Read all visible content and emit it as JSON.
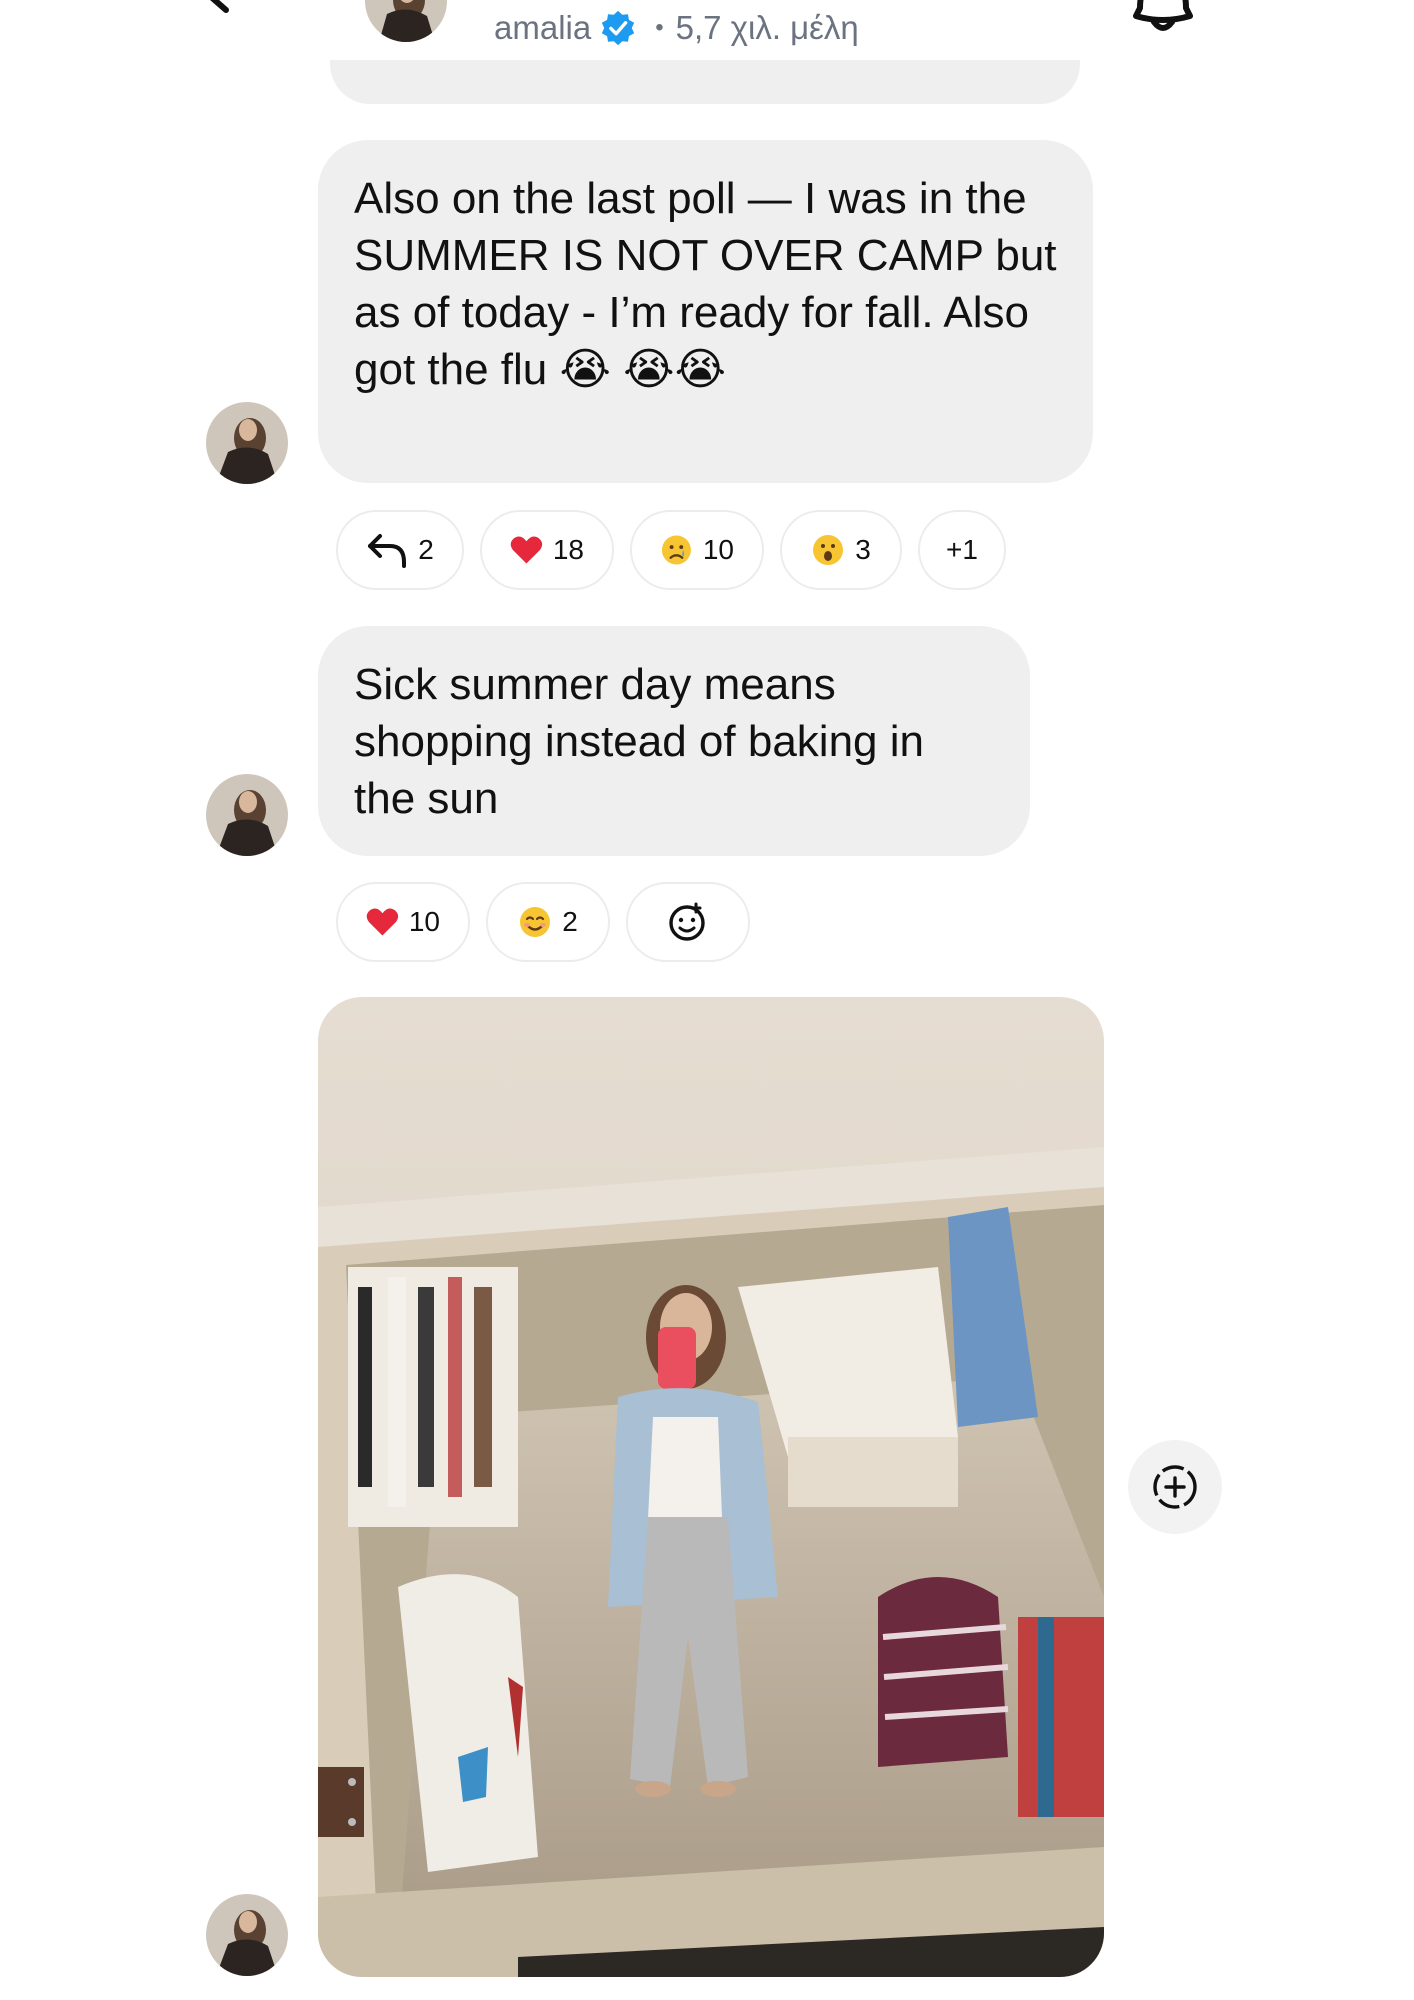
{
  "header": {
    "channel_name": "amalia",
    "separator": "•",
    "members": "5,7 χιλ. μέλη"
  },
  "messages": [
    {
      "text": "Also on the last poll — I was in the SUMMER IS NOT OVER CAMP but as of today - I’m ready for fall. Also got the flu",
      "trailing_emoji": "😭",
      "extra_emoji": "😭😭",
      "reactions": {
        "replies": "2",
        "heart": "18",
        "sad": "10",
        "wow": "3",
        "more": "+1"
      }
    },
    {
      "text": "Sick summer day means shopping instead of baking in the sun",
      "reactions": {
        "heart": "10",
        "smile": "2"
      }
    }
  ],
  "icons": {
    "back": "back-arrow-icon",
    "verified": "verified-badge-icon",
    "bell": "bell-icon",
    "reply": "reply-icon",
    "add_reaction": "add-reaction-icon",
    "add_circle": "add-circle-icon"
  },
  "colors": {
    "bubble": "#efefef",
    "verified": "#1d9bf0",
    "heart": "#e5283c",
    "muted_text": "#6b7280"
  }
}
